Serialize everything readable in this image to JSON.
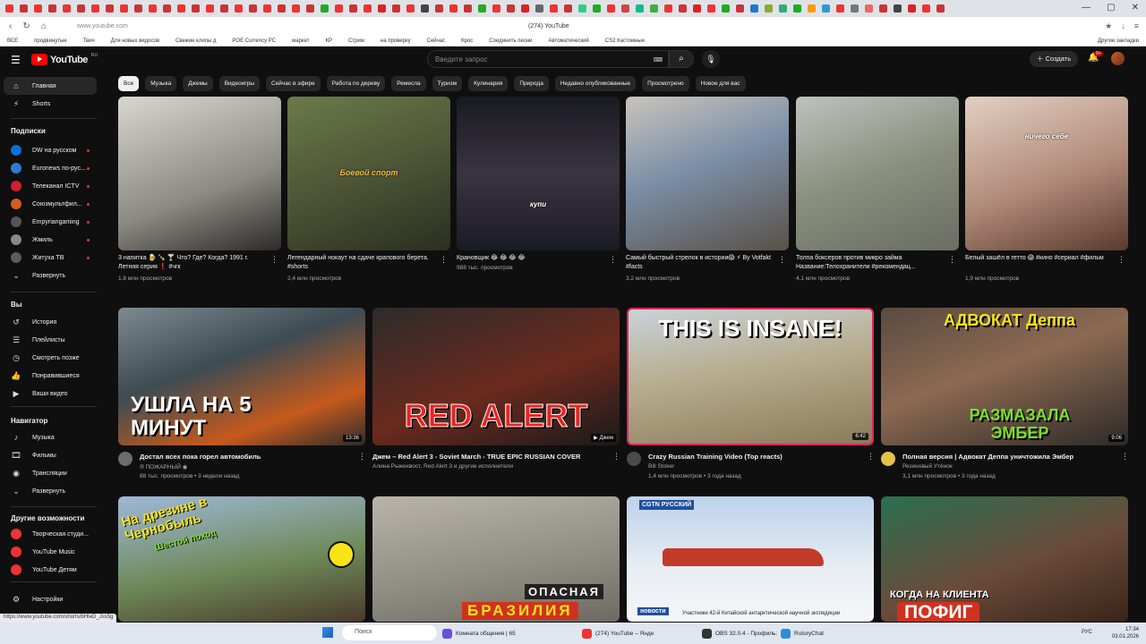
{
  "browser": {
    "url": "www.youtube.com",
    "page_title": "(274) YouTube",
    "bookmarks": [
      "ВСЕ",
      "продвинутые",
      "Твич",
      "Для новых видосов",
      "Свежие клипы д",
      "POE Currency PC",
      "маркет",
      "КР",
      "Стрим",
      "на проверку",
      "Сейчас",
      "Крос",
      "Соединить песни",
      "Автоматический",
      "CS2 Кастомные"
    ],
    "bookmarks_right": "Другие закладки"
  },
  "header": {
    "logo": "YouTube",
    "region": "RU",
    "search_placeholder": "Введите запрос",
    "create_label": "Создать",
    "notif_count": "9+"
  },
  "sidebar": {
    "main": [
      {
        "icon": "home-icon",
        "glyph": "⌂",
        "label": "Главная"
      },
      {
        "icon": "shorts-icon",
        "glyph": "⚡",
        "label": "Shorts"
      }
    ],
    "subs_title": "Подписки",
    "subscriptions": [
      {
        "label": "DW на русском",
        "color": "#0b6fd6"
      },
      {
        "label": "Euronews по-рус...",
        "color": "#2f7ad0"
      },
      {
        "label": "Телеканал ICTV",
        "color": "#d01f2e"
      },
      {
        "label": "Союзмультфил...",
        "color": "#d45c1e"
      },
      {
        "label": "Empyriangaming",
        "color": "#555555"
      },
      {
        "label": "Жмиль",
        "color": "#888888"
      },
      {
        "label": "Житуха ТВ",
        "color": "#5b5b5b"
      }
    ],
    "expand1": "Развернуть",
    "you_title": "Вы",
    "you": [
      {
        "icon": "history-icon",
        "glyph": "↺",
        "label": "История"
      },
      {
        "icon": "playlists-icon",
        "glyph": "☰",
        "label": "Плейлисты"
      },
      {
        "icon": "watch-later-icon",
        "glyph": "◷",
        "label": "Смотреть позже"
      },
      {
        "icon": "liked-icon",
        "glyph": "👍",
        "label": "Понравившиеся"
      },
      {
        "icon": "your-videos-icon",
        "glyph": "▶",
        "label": "Ваши видео"
      }
    ],
    "nav_title": "Навигатор",
    "navigator": [
      {
        "icon": "music-icon",
        "glyph": "♪",
        "label": "Музыка"
      },
      {
        "icon": "films-icon",
        "glyph": "🎞",
        "label": "Фильмы"
      },
      {
        "icon": "live-icon",
        "glyph": "◉",
        "label": "Трансляции"
      }
    ],
    "expand2": "Развернуть",
    "more_title": "Другие возможности",
    "more": [
      {
        "label": "Творческая студи..."
      },
      {
        "label": "YouTube Music"
      },
      {
        "label": "YouTube Детям"
      }
    ],
    "settings": "Настройки"
  },
  "chips": [
    "Все",
    "Музыка",
    "Джемы",
    "Видеоигры",
    "Сейчас в эфире",
    "Работа по дереву",
    "Ремесла",
    "Туризм",
    "Кулинария",
    "Природа",
    "Недавно опубликованные",
    "Просмотрено",
    "Новое для вас"
  ],
  "shorts": [
    {
      "title": "3 напитка 🍺 🍾 🍸 Что? Где? Когда? 1991 г. Летняя серия ❗ #чгк",
      "views": "1,8 млн просмотров",
      "bg": "linear-gradient(160deg,#d9d6cf,#8c8a84 60%,#2d2b28)",
      "overlay": ""
    },
    {
      "title": "Легендарный нокаут на сдаче крапового берета. #shorts",
      "views": "2,4 млн просмотров",
      "bg": "linear-gradient(160deg,#6b7a4a,#4a5234 55%,#2a2f1f)",
      "overlay": "Боевой спорт"
    },
    {
      "title": "Крановщик 😂 😂 😂 😂",
      "views": "988 тыс. просмотров",
      "bg": "linear-gradient(180deg,#1a1a22,#3a3440 50%,#1b1b24)",
      "overlay": "купи"
    },
    {
      "title": "Самый быстрый стрелок в истории😱 ⚡ By Votfakt #facts",
      "views": "3,2 млн просмотров",
      "bg": "linear-gradient(160deg,#c9c4bb,#7b8fa8 45%,#5a5148)",
      "overlay": ""
    },
    {
      "title": "Толпа боксеров против микро займа Название:Телохранители #рекомендац...",
      "views": "4,1 млн просмотров",
      "bg": "linear-gradient(160deg,#bfc1be,#8a8f7e 50%,#6a6d63)",
      "overlay": ""
    },
    {
      "title": "Белый зашёл в гетто 😱 #кино #сериал #фильм",
      "views": "1,9 млн просмотров",
      "bg": "linear-gradient(160deg,#e3cfc2,#b08a78 55%,#5a3a2e)",
      "overlay": "ничего себе"
    }
  ],
  "videos_row1": [
    {
      "title": "Достал всех пока горел автомобиль",
      "channel": "Я ПОЖАРНЫЙ ◉",
      "meta": "88 тыс. просмотров • 3 недели назад",
      "duration": "13:36",
      "thumb_text": "УШЛА НА 5 МИНУТ",
      "bg": "linear-gradient(160deg,#7d8a92,#3d4b52 40%,#c65a1c 75%,#2c2c2c)",
      "av": "#6c6c6c"
    },
    {
      "title": "Джем – Red Alert 3 - Soviet March - TRUE EPIC RUSSIAN COVER",
      "channel": "Алина Рыжехвост, Red Alert 3 и другие исполнители",
      "meta": "",
      "duration": "▶ Джем",
      "thumb_text": "RED ALERT",
      "bg": "linear-gradient(160deg,#2d2b2a,#6b2a1e 55%,#1a1a1a)",
      "av": ""
    },
    {
      "title": "Crazy Russian Training Video (Top reacts)",
      "channel": "Bill Stoker",
      "meta": "1,4 млн просмотров • 3 года назад",
      "duration": "6:42",
      "thumb_text": "THIS IS INSANE!",
      "bg": "linear-gradient(170deg,#c9d3da,#b7ad8f 45%,#8a7a5a)",
      "av": "#4a4a4a"
    },
    {
      "title": "Полная версия | Адвокат Деппа уничтожила Эмбер",
      "channel": "Резиновый Утёнок",
      "meta": "3,1 млн просмотров • 3 года назад",
      "duration": "9:06",
      "thumb_text": "АДВОКАТ Деппа",
      "thumb_text2": "РАЗМАЗАЛА ЭМБЕР",
      "bg": "linear-gradient(160deg,#5a4a40,#8c6a52 45%,#2e2a28)",
      "av": "#e2c24a"
    }
  ],
  "videos_row2": [
    {
      "thumb_text": "На дрезине в Чернобыль",
      "thumb_sub": "Шестой поход",
      "bg": "linear-gradient(170deg,#9fb8d8,#6e8a5a 55%,#4a3a2a)"
    },
    {
      "thumb_text": "ОПАСНАЯ",
      "thumb_sub": "БРАЗИЛИЯ",
      "bg": "linear-gradient(170deg,#b8b4ab,#8e8b80 60%,#6e6a62)"
    },
    {
      "thumb_text": "",
      "thumb_sub": "Участники 42-й Китайской антарктической научной экспедиции",
      "badge": "новости",
      "logo_text": "CGTN РУССКИЙ",
      "bg": "linear-gradient(180deg,#bcd2ec,#e9eef3 60%,#f4f6f8)"
    },
    {
      "thumb_text": "КОГДА НА КЛИЕНТА",
      "thumb_sub": "ПОФИГ",
      "bg": "linear-gradient(160deg,#2a6f4f,#6a4b3a 55%,#3a2418)"
    }
  ],
  "status_url": "https://www.youtube.com/shorts/bHIeD_Jss5g",
  "taskbar": {
    "search": "Поиск",
    "apps": [
      {
        "label": "Комната общения | 65",
        "color": "#6a4ee0"
      },
      {
        "label": "(274) YouTube – Янде",
        "color": "#e33"
      },
      {
        "label": "OBS 32.0.4 - Профиль:",
        "color": "#333"
      },
      {
        "label": "RutoryChat",
        "color": "#2a8fd8"
      }
    ],
    "lang": "РУС",
    "time": "17:34",
    "date": "03.01.2026"
  },
  "colors": {
    "bg": "#0f0f0f",
    "chip": "#272727",
    "accent": "#ff0000"
  }
}
